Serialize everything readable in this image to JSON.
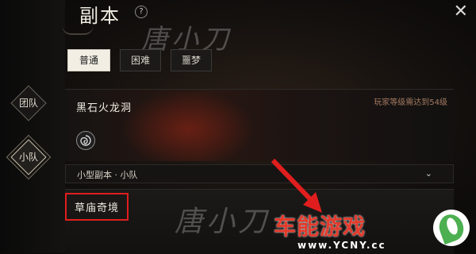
{
  "header": {
    "title": "副本",
    "help_glyph": "?",
    "close_glyph": "✕"
  },
  "watermark_text": "唐小刀",
  "difficulty_tabs": [
    {
      "label": "普通",
      "active": true
    },
    {
      "label": "困难",
      "active": false
    },
    {
      "label": "噩梦",
      "active": false
    }
  ],
  "side_modes": [
    {
      "label": "团队",
      "active": false
    },
    {
      "label": "小队",
      "active": true
    }
  ],
  "dungeon_cards": [
    {
      "name": "黑石火龙洞",
      "requirement": "玩家等级需达到54级"
    },
    {
      "name": "草庙奇境"
    }
  ],
  "dropdown": {
    "label": "小型副本 · 小队"
  },
  "logo": {
    "brand": "车能游戏",
    "url": "www.YCNY.cc"
  },
  "colors": {
    "highlight_box": "#e01e1e",
    "annotation_arrow": "#e01e1e",
    "brand_red": "#e43a2b",
    "brand_green": "#4caf50"
  }
}
